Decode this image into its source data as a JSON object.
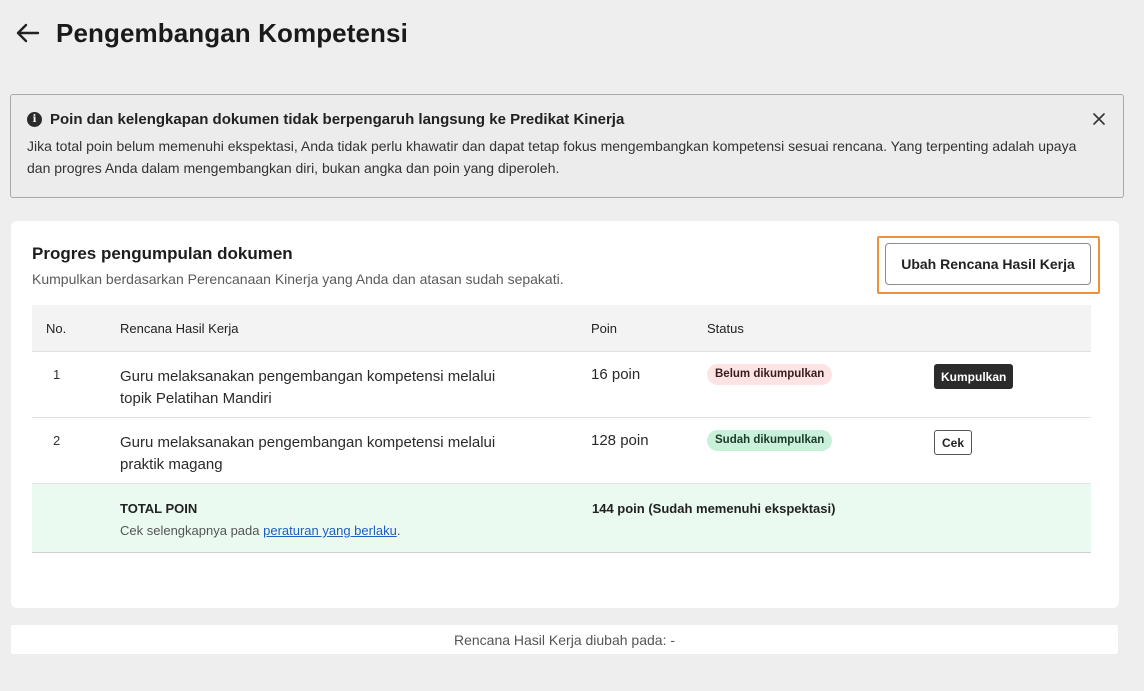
{
  "header": {
    "title": "Pengembangan Kompetensi",
    "back_icon": "arrow-left-icon"
  },
  "alert": {
    "title": "Poin dan kelengkapan dokumen tidak berpengaruh langsung ke Predikat Kinerja",
    "body": "Jika total poin belum memenuhi ekspektasi, Anda tidak perlu khawatir dan dapat tetap fokus mengembangkan kompetensi sesuai rencana. Yang terpenting adalah upaya dan progres Anda dalam mengembangkan diri, bukan angka dan poin yang diperoleh.",
    "info_icon_glyph": "i",
    "close_icon": "close-icon"
  },
  "progress": {
    "title": "Progres pengumpulan dokumen",
    "subtitle": "Kumpulkan berdasarkan Perencanaan Kinerja yang Anda dan atasan sudah sepakati.",
    "edit_button": "Ubah Rencana Hasil Kerja",
    "accent_color": "#f0913a"
  },
  "table": {
    "headers": {
      "no": "No.",
      "plan": "Rencana Hasil Kerja",
      "poin": "Poin",
      "status": "Status"
    },
    "rows": [
      {
        "no": "1",
        "plan": "Guru melaksanakan pengembangan kompetensi melalui topik Pelatihan Mandiri",
        "poin": "16 poin",
        "status": "Belum dikumpulkan",
        "status_color": "#fde4e4",
        "action": "Kumpulkan"
      },
      {
        "no": "2",
        "plan": "Guru melaksanakan pengembangan kompetensi melalui praktik magang",
        "poin": "128 poin",
        "status": "Sudah dikumpulkan",
        "status_color": "#c9f0d9",
        "action": "Cek"
      }
    ],
    "total": {
      "label": "TOTAL POIN",
      "note_prefix": "Cek selengkapnya pada ",
      "note_link": "peraturan yang berlaku",
      "note_suffix": ".",
      "value": "144 poin (Sudah memenuhi ekspektasi)"
    }
  },
  "footer": {
    "text": "Rencana Hasil Kerja diubah pada: -"
  }
}
